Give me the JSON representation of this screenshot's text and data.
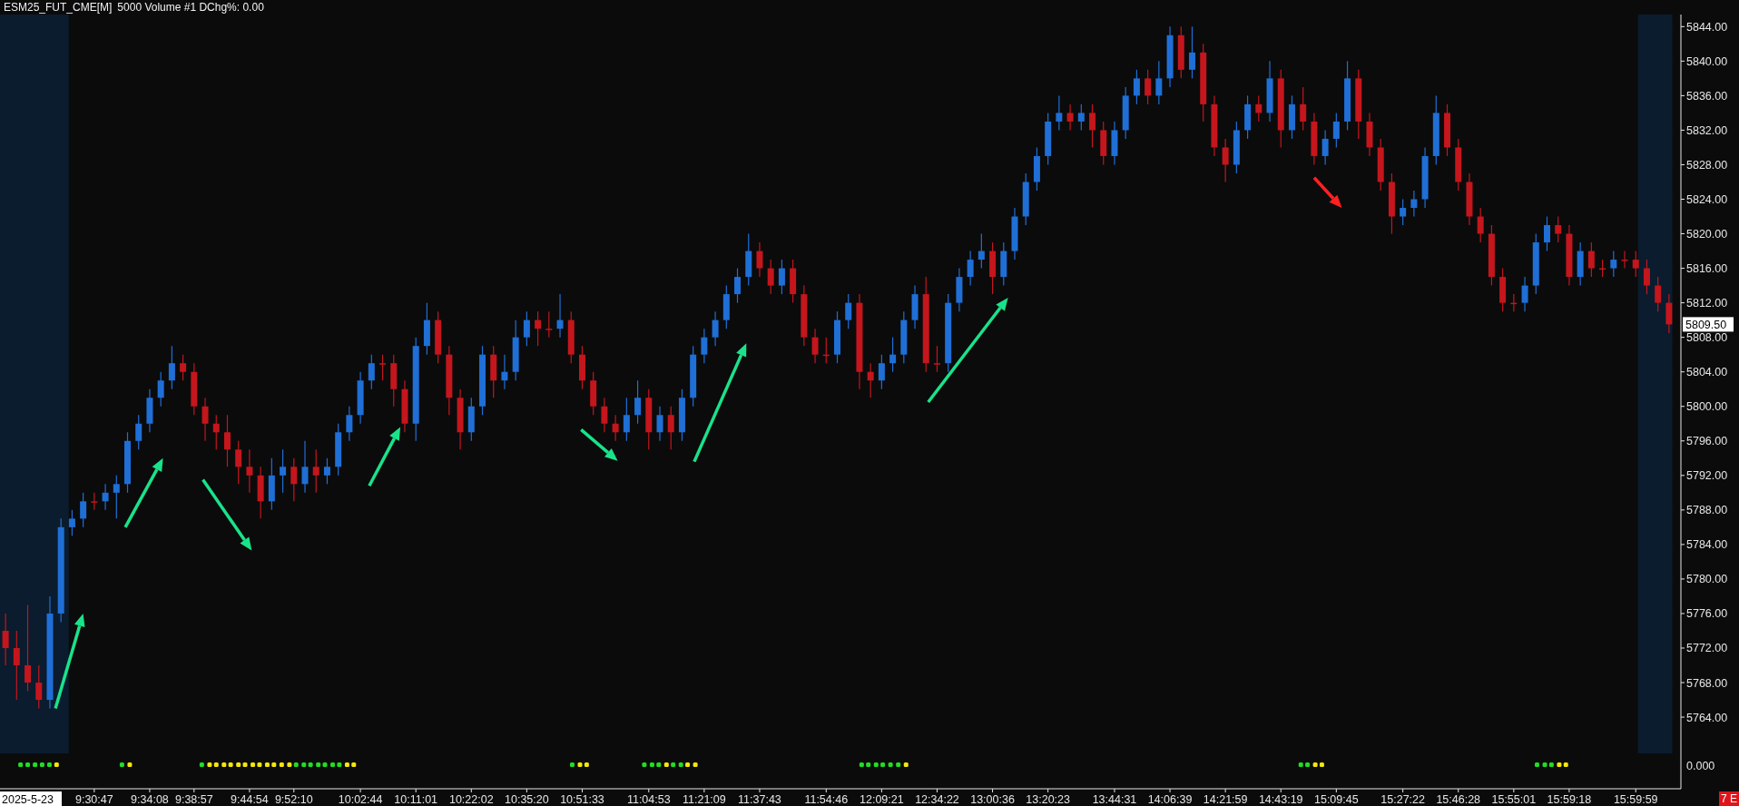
{
  "header": {
    "symbol": "ESM25_FUT_CME[M]",
    "study": "5000 Volume #1 DChg%: 0.00"
  },
  "chart": {
    "chart_data": {
      "type": "candlestick",
      "ylim": [
        5755.7,
        5845.4
      ],
      "yticks": [
        {
          "value": 5764,
          "label": "5764.00"
        },
        {
          "value": 5768,
          "label": "5768.00"
        },
        {
          "value": 5772,
          "label": "5772.00"
        },
        {
          "value": 5776,
          "label": "5776.00"
        },
        {
          "value": 5780,
          "label": "5780.00"
        },
        {
          "value": 5784,
          "label": "5784.00"
        },
        {
          "value": 5788,
          "label": "5788.00"
        },
        {
          "value": 5792,
          "label": "5792.00"
        },
        {
          "value": 5796,
          "label": "5796.00"
        },
        {
          "value": 5800,
          "label": "5800.00"
        },
        {
          "value": 5804,
          "label": "5804.00"
        },
        {
          "value": 5808,
          "label": "5808.00"
        },
        {
          "value": 5812,
          "label": "5812.00"
        },
        {
          "value": 5816,
          "label": "5816.00"
        },
        {
          "value": 5820,
          "label": "5820.00"
        },
        {
          "value": 5824,
          "label": "5824.00"
        },
        {
          "value": 5828,
          "label": "5828.00"
        },
        {
          "value": 5832,
          "label": "5832.00"
        },
        {
          "value": 5836,
          "label": "5836.00"
        },
        {
          "value": 5840,
          "label": "5840.00"
        },
        {
          "value": 5844,
          "label": "5844.00"
        }
      ],
      "categories": [
        null,
        null,
        null,
        null,
        null,
        null,
        null,
        null,
        "9:30:47",
        null,
        null,
        null,
        null,
        "9:34:08",
        null,
        null,
        null,
        "9:38:57",
        null,
        null,
        null,
        null,
        "9:44:54",
        null,
        null,
        null,
        "9:52:10",
        null,
        null,
        null,
        null,
        null,
        "10:02:44",
        null,
        null,
        null,
        null,
        "10:11:01",
        null,
        null,
        null,
        null,
        "10:22:02",
        null,
        null,
        null,
        null,
        "10:35:20",
        null,
        null,
        null,
        null,
        "10:51:33",
        null,
        null,
        null,
        null,
        null,
        "11:04:53",
        null,
        null,
        null,
        null,
        "11:21:09",
        null,
        null,
        null,
        null,
        "11:37:43",
        null,
        null,
        null,
        null,
        null,
        "11:54:46",
        null,
        null,
        null,
        null,
        "12:09:21",
        null,
        null,
        null,
        null,
        "12:34:22",
        null,
        null,
        null,
        null,
        "13:00:36",
        null,
        null,
        null,
        null,
        "13:20:23",
        null,
        null,
        null,
        null,
        null,
        "13:44:31",
        null,
        null,
        null,
        null,
        "14:06:39",
        null,
        null,
        null,
        null,
        "14:21:59",
        null,
        null,
        null,
        null,
        "14:43:19",
        null,
        null,
        null,
        null,
        "15:09:45",
        null,
        null,
        null,
        null,
        null,
        "15:27:22",
        null,
        null,
        null,
        null,
        "15:46:28",
        null,
        null,
        null,
        null,
        "15:55:01",
        null,
        null,
        null,
        null,
        "15:59:18",
        null,
        null,
        null,
        null,
        null,
        "15:59:59",
        null,
        null,
        null
      ],
      "ohlc": [
        [
          5774,
          5776,
          5770,
          5772
        ],
        [
          5772,
          5774,
          5766,
          5770
        ],
        [
          5770,
          5777,
          5767,
          5768
        ],
        [
          5768,
          5770,
          5765,
          5766
        ],
        [
          5766,
          5778,
          5765,
          5776
        ],
        [
          5776,
          5787,
          5775,
          5786
        ],
        [
          5786,
          5788,
          5785,
          5787
        ],
        [
          5787,
          5790,
          5786,
          5789
        ],
        [
          5789,
          5790,
          5788,
          5789
        ],
        [
          5789,
          5791,
          5788,
          5790
        ],
        [
          5790,
          5792,
          5787,
          5791
        ],
        [
          5791,
          5797,
          5790,
          5796
        ],
        [
          5796,
          5799,
          5795,
          5798
        ],
        [
          5798,
          5802,
          5797,
          5801
        ],
        [
          5801,
          5804,
          5800,
          5803
        ],
        [
          5803,
          5807,
          5802,
          5805
        ],
        [
          5805,
          5806,
          5803,
          5804
        ],
        [
          5804,
          5805,
          5799,
          5800
        ],
        [
          5800,
          5801,
          5796,
          5798
        ],
        [
          5798,
          5799,
          5795,
          5797
        ],
        [
          5797,
          5799,
          5793,
          5795
        ],
        [
          5795,
          5796,
          5791,
          5793
        ],
        [
          5793,
          5795,
          5790,
          5792
        ],
        [
          5792,
          5793,
          5787,
          5789
        ],
        [
          5789,
          5794,
          5788,
          5792
        ],
        [
          5792,
          5795,
          5790,
          5793
        ],
        [
          5793,
          5794,
          5789,
          5791
        ],
        [
          5791,
          5796,
          5790,
          5793
        ],
        [
          5793,
          5795,
          5790,
          5792
        ],
        [
          5792,
          5794,
          5791,
          5793
        ],
        [
          5793,
          5798,
          5792,
          5797
        ],
        [
          5797,
          5800,
          5796,
          5799
        ],
        [
          5799,
          5804,
          5798,
          5803
        ],
        [
          5803,
          5806,
          5802,
          5805
        ],
        [
          5805,
          5806,
          5803,
          5805
        ],
        [
          5805,
          5806,
          5800,
          5802
        ],
        [
          5802,
          5803,
          5797,
          5798
        ],
        [
          5798,
          5808,
          5796,
          5807
        ],
        [
          5807,
          5812,
          5806,
          5810
        ],
        [
          5810,
          5811,
          5805,
          5806
        ],
        [
          5806,
          5807,
          5799,
          5801
        ],
        [
          5801,
          5802,
          5795,
          5797
        ],
        [
          5797,
          5801,
          5796,
          5800
        ],
        [
          5800,
          5807,
          5799,
          5806
        ],
        [
          5806,
          5807,
          5801,
          5803
        ],
        [
          5803,
          5806,
          5802,
          5804
        ],
        [
          5804,
          5810,
          5803,
          5808
        ],
        [
          5808,
          5811,
          5807,
          5810
        ],
        [
          5810,
          5811,
          5807,
          5809
        ],
        [
          5809,
          5811,
          5808,
          5809
        ],
        [
          5809,
          5813,
          5808,
          5810
        ],
        [
          5810,
          5811,
          5805,
          5806
        ],
        [
          5806,
          5807,
          5802,
          5803
        ],
        [
          5803,
          5804,
          5799,
          5800
        ],
        [
          5800,
          5801,
          5797,
          5798
        ],
        [
          5798,
          5799,
          5796,
          5797
        ],
        [
          5797,
          5801,
          5796,
          5799
        ],
        [
          5799,
          5803,
          5798,
          5801
        ],
        [
          5801,
          5802,
          5795,
          5797
        ],
        [
          5797,
          5800,
          5796,
          5799
        ],
        [
          5799,
          5800,
          5795,
          5797
        ],
        [
          5797,
          5802,
          5796,
          5801
        ],
        [
          5801,
          5807,
          5800,
          5806
        ],
        [
          5806,
          5809,
          5805,
          5808
        ],
        [
          5808,
          5811,
          5807,
          5810
        ],
        [
          5810,
          5814,
          5809,
          5813
        ],
        [
          5813,
          5816,
          5812,
          5815
        ],
        [
          5815,
          5820,
          5814,
          5818
        ],
        [
          5818,
          5819,
          5815,
          5816
        ],
        [
          5816,
          5817,
          5813,
          5814
        ],
        [
          5814,
          5817,
          5813,
          5816
        ],
        [
          5816,
          5817,
          5812,
          5813
        ],
        [
          5813,
          5814,
          5807,
          5808
        ],
        [
          5808,
          5809,
          5805,
          5806
        ],
        [
          5806,
          5808,
          5805,
          5806
        ],
        [
          5806,
          5811,
          5805,
          5810
        ],
        [
          5810,
          5813,
          5809,
          5812
        ],
        [
          5812,
          5813,
          5802,
          5804
        ],
        [
          5804,
          5805,
          5801,
          5803
        ],
        [
          5803,
          5806,
          5802,
          5805
        ],
        [
          5805,
          5808,
          5804,
          5806
        ],
        [
          5806,
          5811,
          5805,
          5810
        ],
        [
          5810,
          5814,
          5809,
          5813
        ],
        [
          5813,
          5815,
          5804,
          5805
        ],
        [
          5805,
          5807,
          5804,
          5805
        ],
        [
          5805,
          5813,
          5804,
          5812
        ],
        [
          5812,
          5816,
          5811,
          5815
        ],
        [
          5815,
          5818,
          5814,
          5817
        ],
        [
          5817,
          5820,
          5816,
          5818
        ],
        [
          5818,
          5819,
          5813,
          5815
        ],
        [
          5815,
          5819,
          5814,
          5818
        ],
        [
          5818,
          5823,
          5817,
          5822
        ],
        [
          5822,
          5827,
          5821,
          5826
        ],
        [
          5826,
          5830,
          5825,
          5829
        ],
        [
          5829,
          5834,
          5828,
          5833
        ],
        [
          5833,
          5836,
          5832,
          5834
        ],
        [
          5834,
          5835,
          5832,
          5833
        ],
        [
          5833,
          5835,
          5832,
          5834
        ],
        [
          5834,
          5835,
          5830,
          5832
        ],
        [
          5832,
          5833,
          5828,
          5829
        ],
        [
          5829,
          5833,
          5828,
          5832
        ],
        [
          5832,
          5837,
          5831,
          5836
        ],
        [
          5836,
          5839,
          5835,
          5838
        ],
        [
          5838,
          5839,
          5835,
          5836
        ],
        [
          5836,
          5840,
          5835,
          5838
        ],
        [
          5838,
          5844,
          5837,
          5843
        ],
        [
          5843,
          5844,
          5838,
          5839
        ],
        [
          5839,
          5844,
          5838,
          5841
        ],
        [
          5841,
          5842,
          5833,
          5835
        ],
        [
          5835,
          5836,
          5829,
          5830
        ],
        [
          5830,
          5831,
          5826,
          5828
        ],
        [
          5828,
          5833,
          5827,
          5832
        ],
        [
          5832,
          5836,
          5831,
          5835
        ],
        [
          5835,
          5836,
          5833,
          5834
        ],
        [
          5834,
          5840,
          5833,
          5838
        ],
        [
          5838,
          5839,
          5830,
          5832
        ],
        [
          5832,
          5836,
          5831,
          5835
        ],
        [
          5835,
          5837,
          5832,
          5833
        ],
        [
          5833,
          5834,
          5828,
          5829
        ],
        [
          5829,
          5832,
          5828,
          5831
        ],
        [
          5831,
          5834,
          5830,
          5833
        ],
        [
          5833,
          5840,
          5832,
          5838
        ],
        [
          5838,
          5839,
          5831,
          5833
        ],
        [
          5833,
          5834,
          5829,
          5830
        ],
        [
          5830,
          5831,
          5825,
          5826
        ],
        [
          5826,
          5827,
          5820,
          5822
        ],
        [
          5822,
          5824,
          5821,
          5823
        ],
        [
          5823,
          5825,
          5822,
          5824
        ],
        [
          5824,
          5830,
          5823,
          5829
        ],
        [
          5829,
          5836,
          5828,
          5834
        ],
        [
          5834,
          5835,
          5829,
          5830
        ],
        [
          5830,
          5831,
          5825,
          5826
        ],
        [
          5826,
          5827,
          5821,
          5822
        ],
        [
          5822,
          5823,
          5819,
          5820
        ],
        [
          5820,
          5821,
          5814,
          5815
        ],
        [
          5815,
          5816,
          5811,
          5812
        ],
        [
          5812,
          5813,
          5811,
          5812
        ],
        [
          5812,
          5815,
          5811,
          5814
        ],
        [
          5814,
          5820,
          5813,
          5819
        ],
        [
          5819,
          5822,
          5818,
          5821
        ],
        [
          5821,
          5822,
          5819,
          5820
        ],
        [
          5820,
          5821,
          5814,
          5815
        ],
        [
          5815,
          5819,
          5814,
          5818
        ],
        [
          5818,
          5819,
          5815,
          5816
        ],
        [
          5816,
          5817,
          5815,
          5816
        ],
        [
          5816,
          5818,
          5815,
          5817
        ],
        [
          5817,
          5818,
          5816,
          5817
        ],
        [
          5817,
          5818,
          5815,
          5816
        ],
        [
          5816,
          5817,
          5813,
          5814
        ],
        [
          5814,
          5815,
          5811,
          5812
        ],
        [
          5812,
          5813,
          5808.5,
          5809.5
        ]
      ]
    }
  },
  "last_price": "5809.50",
  "date_label": "2025-5-23",
  "arrows": [
    {
      "color": "#19e38a"
    },
    {
      "color": "#19e38a"
    },
    {
      "color": "#19e38a"
    },
    {
      "color": "#19e38a"
    },
    {
      "color": "#19e38a"
    },
    {
      "color": "#19e38a"
    },
    {
      "color": "#19e38a"
    },
    {
      "color": "#ff2020"
    }
  ],
  "indicator": {
    "axis_label": "0.000",
    "dots": [
      {
        "color": "#22dd22"
      },
      {
        "color": "#22dd22"
      },
      {
        "color": "#22dd22"
      },
      {
        "color": "#22dd22"
      },
      {
        "color": "#22dd22"
      },
      {
        "color": "#f5e60a"
      },
      {
        "color": "#22dd22"
      },
      {
        "color": "#f5e60a"
      },
      {
        "color": "#22dd22"
      },
      {
        "color": "#f5e60a"
      },
      {
        "color": "#f5e60a"
      },
      {
        "color": "#f5e60a"
      },
      {
        "color": "#f5e60a"
      },
      {
        "color": "#f5e60a"
      },
      {
        "color": "#f5e60a"
      },
      {
        "color": "#f5e60a"
      },
      {
        "color": "#f5e60a"
      },
      {
        "color": "#f5e60a"
      },
      {
        "color": "#f5e60a"
      },
      {
        "color": "#f5e60a"
      },
      {
        "color": "#f5e60a"
      },
      {
        "color": "#22dd22"
      },
      {
        "color": "#22dd22"
      },
      {
        "color": "#22dd22"
      },
      {
        "color": "#22dd22"
      },
      {
        "color": "#22dd22"
      },
      {
        "color": "#22dd22"
      },
      {
        "color": "#22dd22"
      },
      {
        "color": "#f5e60a"
      },
      {
        "color": "#f5e60a"
      },
      {
        "color": "#22dd22"
      },
      {
        "color": "#f5e60a"
      },
      {
        "color": "#f5e60a"
      },
      {
        "color": "#22dd22"
      },
      {
        "color": "#22dd22"
      },
      {
        "color": "#22dd22"
      },
      {
        "color": "#f5e60a"
      },
      {
        "color": "#22dd22"
      },
      {
        "color": "#22dd22"
      },
      {
        "color": "#f5e60a"
      },
      {
        "color": "#f5e60a"
      },
      {
        "color": "#22dd22"
      },
      {
        "color": "#22dd22"
      },
      {
        "color": "#22dd22"
      },
      {
        "color": "#22dd22"
      },
      {
        "color": "#22dd22"
      },
      {
        "color": "#22dd22"
      },
      {
        "color": "#f5e60a"
      },
      {
        "color": "#22dd22"
      },
      {
        "color": "#22dd22"
      },
      {
        "color": "#f5e60a"
      },
      {
        "color": "#f5e60a"
      },
      {
        "color": "#22dd22"
      },
      {
        "color": "#22dd22"
      },
      {
        "color": "#22dd22"
      },
      {
        "color": "#f5e60a"
      },
      {
        "color": "#f5e60a"
      }
    ]
  },
  "status_badge": "7 E"
}
